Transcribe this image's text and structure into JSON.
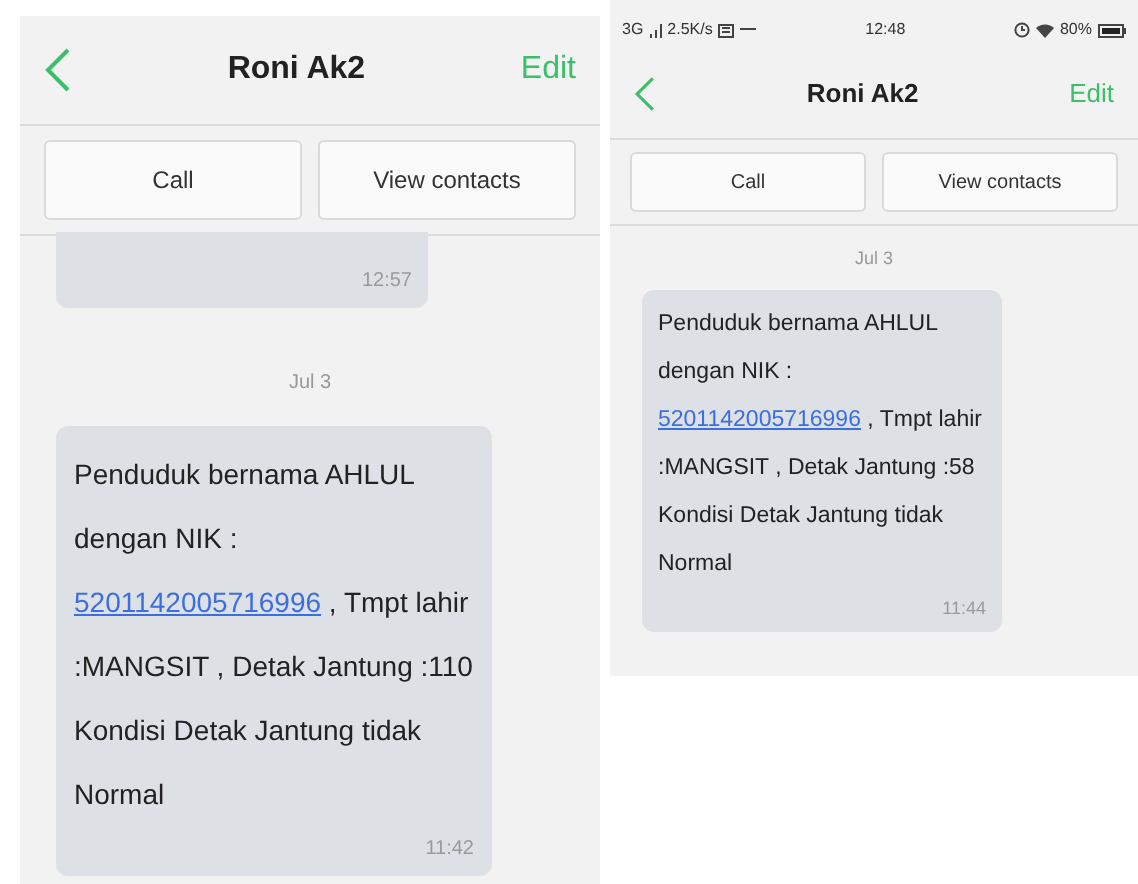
{
  "screens": [
    {
      "kind": "large",
      "header": {
        "title": "Roni Ak2",
        "action": "Edit"
      },
      "buttons": [
        "Call",
        "View contacts"
      ],
      "messages": [
        {
          "kind": "partial",
          "time": "12:57"
        },
        {
          "kind": "date",
          "text": "Jul 3"
        },
        {
          "kind": "received",
          "text_before": "Penduduk bernama AHLUL dengan NIK : ",
          "link": "5201142005716996",
          "text_after": " , Tmpt lahir :MANGSIT , Detak Jantung :110 Kondisi Detak Jantung tidak Normal",
          "time": "11:42"
        }
      ]
    },
    {
      "kind": "small",
      "status_bar": {
        "network": "3G",
        "speed": "2.5K/s",
        "time": "12:48",
        "battery": "80%"
      },
      "header": {
        "title": "Roni Ak2",
        "action": "Edit"
      },
      "buttons": [
        "Call",
        "View contacts"
      ],
      "messages": [
        {
          "kind": "date",
          "text": "Jul 3"
        },
        {
          "kind": "received",
          "text_before": "Penduduk bernama AHLUL dengan NIK : ",
          "link": "5201142005716996",
          "text_after": " , Tmpt lahir :MANGSIT , Detak Jantung :58 Kondisi Detak Jantung tidak Normal",
          "time": "11:44"
        }
      ]
    }
  ]
}
